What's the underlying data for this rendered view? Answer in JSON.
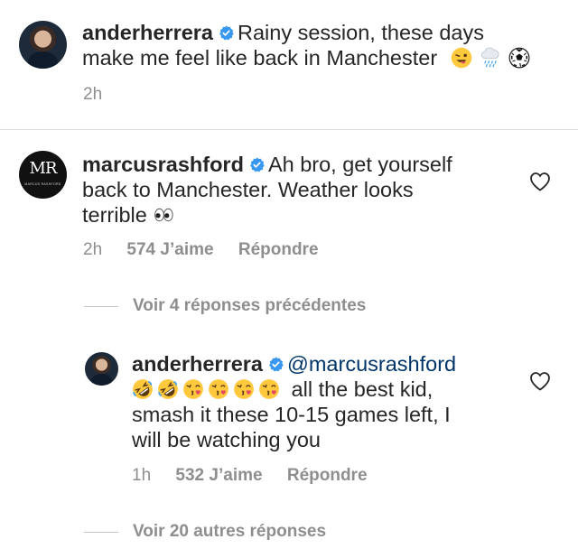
{
  "post": {
    "username": "anderherrera",
    "caption_line1": "Rainy session, these days",
    "caption_line2": "make me feel like back in Manchester",
    "emojis": [
      "winking-tongue-emoji",
      "cloud-rain-emoji",
      "soccer-ball-emoji"
    ],
    "time": "2h"
  },
  "comment": {
    "username": "marcusrashford",
    "line1": "Ah bro, get yourself",
    "line2": "back to Manchester. Weather looks",
    "line3": "terrible",
    "emojis": [
      "eyes-emoji"
    ],
    "time": "2h",
    "likes": "574 J’aime",
    "reply_label": "Répondre",
    "avatar_monogram": "MR",
    "avatar_subtext": "MARCUS RASHFORD"
  },
  "view_previous_replies": "Voir 4 réponses précédentes",
  "reply": {
    "username": "anderherrera",
    "mention": "@marcusrashford",
    "emojis": [
      "rofl-emoji",
      "rofl-emoji",
      "kissing-heart-emoji",
      "kissing-heart-emoji",
      "kissing-heart-emoji",
      "kissing-heart-emoji"
    ],
    "line1_text": "all the best kid,",
    "line2": "smash it these 10-15 games left, I",
    "line3": "will be watching you",
    "time": "1h",
    "likes": "532 J’aime",
    "reply_label": "Répondre"
  },
  "view_more_replies": "Voir 20 autres réponses",
  "colors": {
    "verified_badge": "#3897f0",
    "meta_text": "#8e8e8e",
    "primary_text": "#262626",
    "mention": "#003569"
  }
}
